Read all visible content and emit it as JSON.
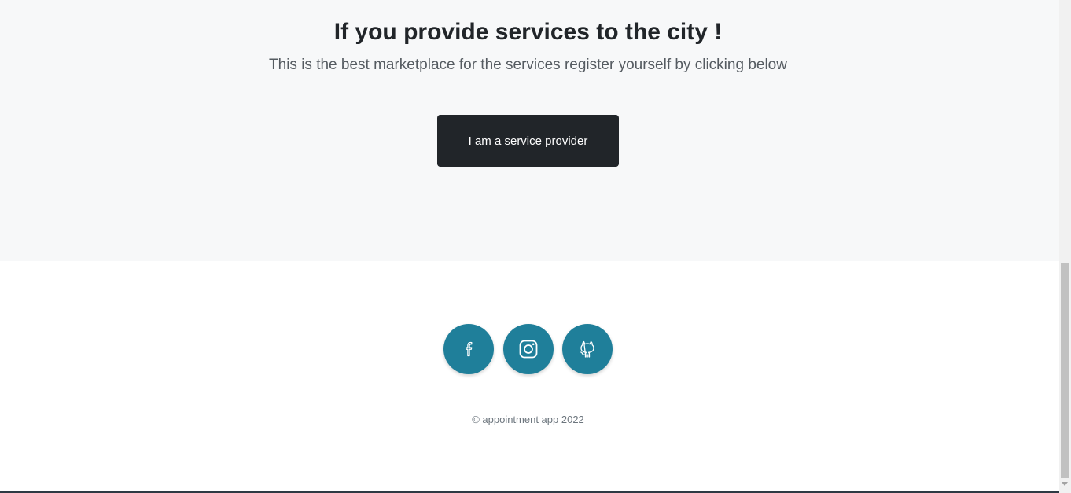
{
  "cta": {
    "title": "If you provide services to the city !",
    "subtitle": "This is the best marketplace for the services register yourself by clicking below",
    "button_label": "I am a service provider"
  },
  "footer": {
    "social": [
      {
        "name": "facebook",
        "icon": "facebook-icon"
      },
      {
        "name": "instagram",
        "icon": "instagram-icon"
      },
      {
        "name": "github",
        "icon": "github-icon"
      }
    ],
    "copyright": "© appointment app 2022"
  },
  "colors": {
    "cta_background": "#f7f8f9",
    "button_dark": "#212529",
    "social_teal": "#1f7f9a"
  }
}
